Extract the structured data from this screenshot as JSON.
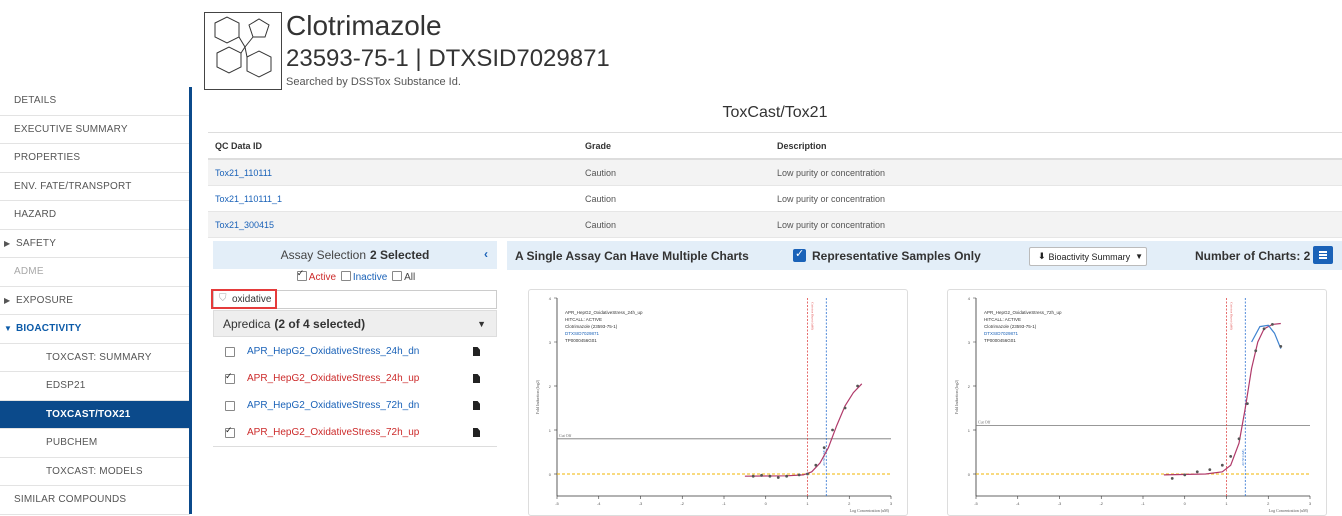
{
  "header": {
    "compound_name": "Clotrimazole",
    "ids": "23593-75-1 | DTXSID7029871",
    "searched_by": "Searched by DSSTox Substance Id."
  },
  "sidebar": {
    "items": [
      {
        "label": "DETAILS"
      },
      {
        "label": "EXECUTIVE SUMMARY"
      },
      {
        "label": "PROPERTIES"
      },
      {
        "label": "ENV. FATE/TRANSPORT"
      },
      {
        "label": "HAZARD"
      },
      {
        "label": "SAFETY"
      },
      {
        "label": "ADME"
      },
      {
        "label": "EXPOSURE"
      },
      {
        "label": "BIOACTIVITY"
      },
      {
        "label": "TOXCAST: SUMMARY"
      },
      {
        "label": "EDSP21"
      },
      {
        "label": "TOXCAST/TOX21"
      },
      {
        "label": "PUBCHEM"
      },
      {
        "label": "TOXCAST: MODELS"
      },
      {
        "label": "SIMILAR COMPOUNDS"
      }
    ],
    "accent_color": "#0b4a8b"
  },
  "section": {
    "title": "ToxCast/Tox21"
  },
  "qc_table": {
    "headers": [
      "QC Data ID",
      "Grade",
      "Description"
    ],
    "rows": [
      [
        "Tox21_110111",
        "Caution",
        "Low purity or concentration"
      ],
      [
        "Tox21_110111_1",
        "Caution",
        "Low purity or concentration"
      ],
      [
        "Tox21_300415",
        "Caution",
        "Low purity or concentration"
      ]
    ]
  },
  "assay_panel": {
    "title": "Assay Selection",
    "selected_count": "2 Selected",
    "collapse_icon": "‹",
    "filters": {
      "active": "Active",
      "inactive": "Inactive",
      "all": "All"
    },
    "search_value": "oxidative",
    "group": {
      "name": "Apredica",
      "count": "(2 of 4 selected)"
    },
    "items": [
      {
        "label": "APR_HepG2_OxidativeStress_24h_dn",
        "checked": false
      },
      {
        "label": "APR_HepG2_OxidativeStress_24h_up",
        "checked": true
      },
      {
        "label": "APR_HepG2_OxidativeStress_72h_dn",
        "checked": false
      },
      {
        "label": "APR_HepG2_OxidativeStress_72h_up",
        "checked": true
      }
    ]
  },
  "chart_toolbar": {
    "title": "A Single Assay Can Have Multiple Charts",
    "representative_label": "Representative Samples Only",
    "bioactivity_button": "Bioactivity Summary",
    "num_charts_label": "Number of Charts: 2"
  },
  "charts": [
    {
      "assay": "APR_HepG2_OxidativeStress_24h_up",
      "hitcall": "HITCALL: ACTIVE",
      "chemical": "Clotrimazole (23593-75-1)",
      "dtxsid": "DTXSID7029871",
      "sample": "TP0000456G01",
      "ylabel": "Fold Induction (log2)",
      "xlabel": "Log Concentration (uM)",
      "cutoff_label": "Cut Off",
      "cytotox_label": "Cytotox Burst (uM)",
      "ac50_label": "AC50 (uM)",
      "cutoff": 0.8,
      "cytotox_x": 1.0,
      "ac50_x": 1.45,
      "xlim": [
        -5,
        3
      ],
      "ylim": [
        -0.5,
        4
      ],
      "xticks": [
        -5,
        -4,
        -3,
        -2,
        -1,
        0,
        1,
        2,
        3
      ],
      "yticks": [
        0,
        1,
        2,
        3,
        4
      ],
      "points": [
        [
          -0.3,
          -0.05
        ],
        [
          -0.1,
          -0.03
        ],
        [
          0.1,
          -0.05
        ],
        [
          0.3,
          -0.08
        ],
        [
          0.5,
          -0.05
        ],
        [
          0.8,
          -0.02
        ],
        [
          1.0,
          0.0
        ],
        [
          1.2,
          0.2
        ],
        [
          1.4,
          0.6
        ],
        [
          1.6,
          1.0
        ],
        [
          1.9,
          1.5
        ],
        [
          2.2,
          2.0
        ]
      ],
      "fit": [
        [
          -0.5,
          -0.05
        ],
        [
          0.5,
          -0.04
        ],
        [
          0.9,
          -0.02
        ],
        [
          1.1,
          0.05
        ],
        [
          1.3,
          0.25
        ],
        [
          1.5,
          0.6
        ],
        [
          1.7,
          1.1
        ],
        [
          1.9,
          1.55
        ],
        [
          2.1,
          1.85
        ],
        [
          2.3,
          2.05
        ]
      ]
    },
    {
      "assay": "APR_HepG2_OxidativeStress_72h_up",
      "hitcall": "HITCALL: ACTIVE",
      "chemical": "Clotrimazole (23593-75-1)",
      "dtxsid": "DTXSID7029871",
      "sample": "TP0000456G01",
      "ylabel": "Fold Induction (log2)",
      "xlabel": "Log Concentration (uM)",
      "cutoff_label": "Cut Off",
      "cytotox_label": "Cytotox Burst (uM)",
      "ac50_label": "AC50 (uM)",
      "cutoff": 1.1,
      "cytotox_x": 1.0,
      "ac50_x": 1.45,
      "xlim": [
        -5,
        3
      ],
      "ylim": [
        -0.5,
        4
      ],
      "xticks": [
        -5,
        -4,
        -3,
        -2,
        -1,
        0,
        1,
        2,
        3
      ],
      "yticks": [
        0,
        1,
        2,
        3,
        4
      ],
      "points": [
        [
          -0.3,
          -0.1
        ],
        [
          0.0,
          -0.02
        ],
        [
          0.3,
          0.05
        ],
        [
          0.6,
          0.1
        ],
        [
          0.9,
          0.2
        ],
        [
          1.1,
          0.4
        ],
        [
          1.3,
          0.8
        ],
        [
          1.5,
          1.6
        ],
        [
          1.7,
          2.8
        ],
        [
          1.9,
          3.3
        ],
        [
          2.1,
          3.4
        ],
        [
          2.3,
          2.9
        ]
      ],
      "fit": [
        [
          -0.5,
          -0.02
        ],
        [
          0.5,
          0.0
        ],
        [
          0.9,
          0.05
        ],
        [
          1.1,
          0.2
        ],
        [
          1.3,
          0.7
        ],
        [
          1.45,
          1.5
        ],
        [
          1.6,
          2.4
        ],
        [
          1.75,
          3.0
        ],
        [
          1.9,
          3.3
        ],
        [
          2.1,
          3.4
        ],
        [
          2.3,
          3.42
        ]
      ],
      "fit2": [
        [
          1.6,
          3.0
        ],
        [
          1.8,
          3.35
        ],
        [
          2.0,
          3.38
        ],
        [
          2.15,
          3.2
        ],
        [
          2.3,
          2.85
        ]
      ]
    }
  ],
  "colors": {
    "link": "#1a62b8",
    "selected": "#cc2b2b",
    "cytotox_line": "#e04a4a",
    "ac50_line": "#2a6fd0",
    "baseline": "#f0b400",
    "fit_curve": "#b03a6a",
    "fit_curve2": "#3f83d0"
  }
}
